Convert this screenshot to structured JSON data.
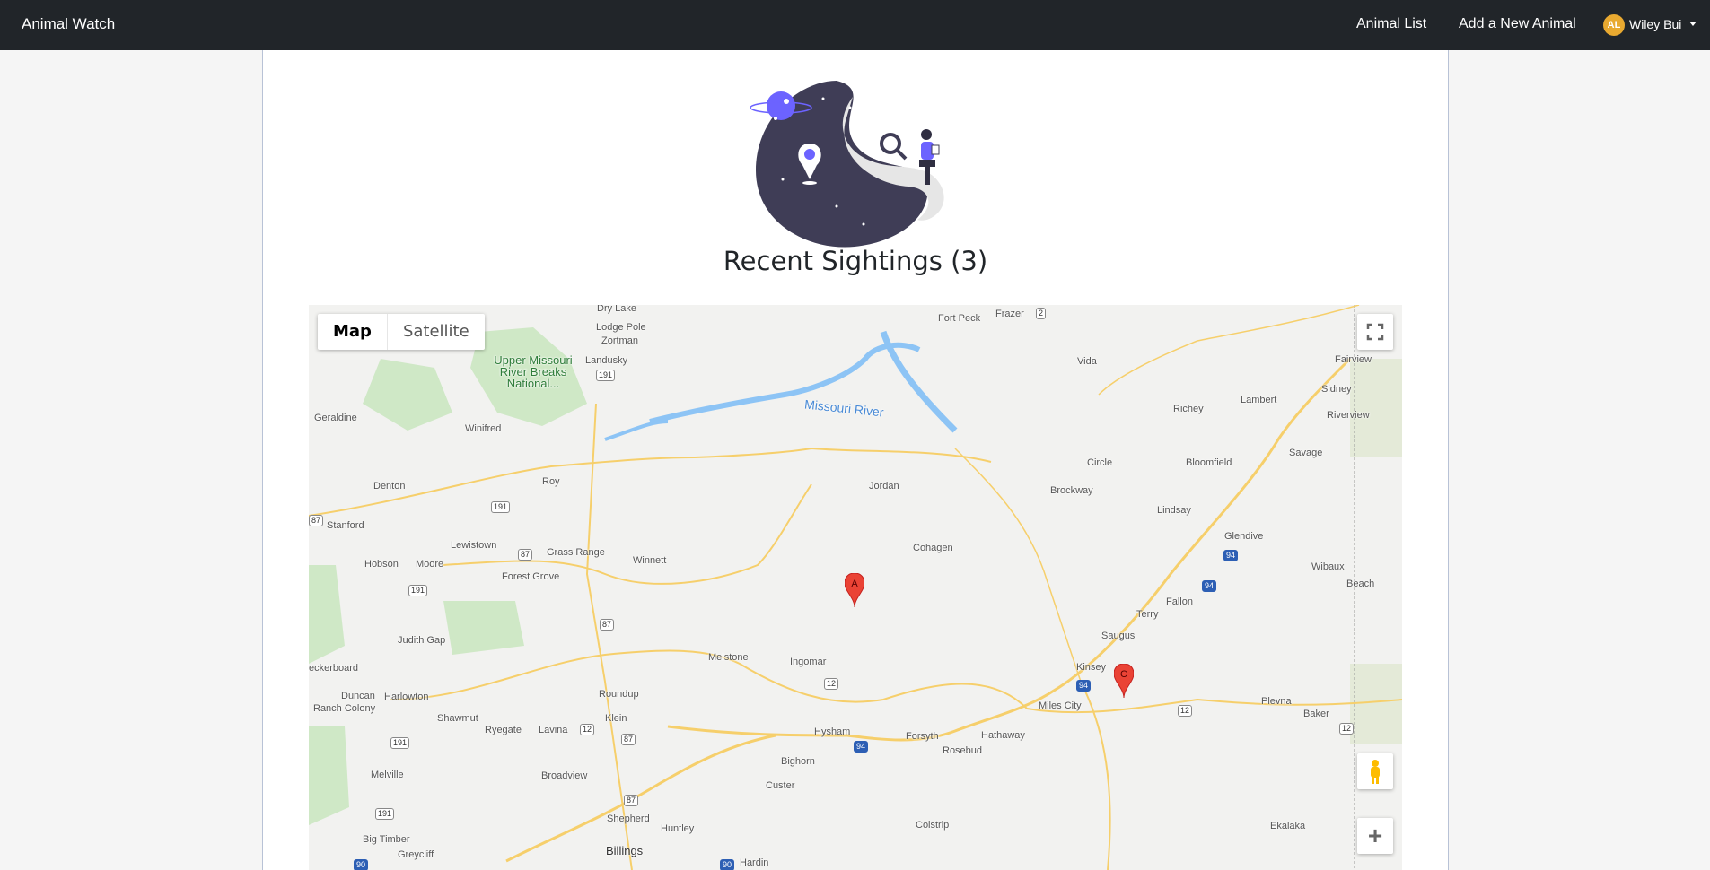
{
  "navbar": {
    "brand": "Animal Watch",
    "links": [
      "Animal List",
      "Add a New Animal"
    ],
    "user": {
      "initials": "AL",
      "name": "Wiley Bui"
    }
  },
  "page": {
    "title": "Recent Sightings (3)"
  },
  "map": {
    "map_type": {
      "map": "Map",
      "satellite": "Satellite"
    },
    "zoom_in": "+",
    "markers": [
      "A",
      "C"
    ],
    "places": [
      "Dry Lake",
      "Lodge Pole",
      "Zortman",
      "Landusky",
      "Upper Missouri River Breaks National...",
      "Geraldine",
      "Winifred",
      "Denton",
      "Roy",
      "Stanford",
      "Lewistown",
      "Grass Range",
      "Winnett",
      "Hobson",
      "Moore",
      "Forest Grove",
      "Judith Gap",
      "eckerboard",
      "Duncan",
      "Harlowton",
      "Ranch Colony",
      "Shawmut",
      "Ryegate",
      "Lavina",
      "Klein",
      "Roundup",
      "Melstone",
      "Ingomar",
      "Melville",
      "Broadview",
      "Big Timber",
      "Greycliff",
      "Shepherd",
      "Huntley",
      "Billings",
      "Hardin",
      "Bighorn",
      "Custer",
      "Hysham",
      "Forsyth",
      "Rosebud",
      "Hathaway",
      "Colstrip",
      "Jordan",
      "Cohagen",
      "Fort Peck",
      "Frazer",
      "Vida",
      "Missouri River",
      "Circle",
      "Brockway",
      "Richey",
      "Lambert",
      "Sidney",
      "Fairview",
      "Riverview",
      "Savage",
      "Bloomfield",
      "Lindsay",
      "Glendive",
      "Wibaux",
      "Beach",
      "Fallon",
      "Terry",
      "Saugus",
      "Kinsey",
      "Miles City",
      "Plevna",
      "Baker",
      "Ekalaka"
    ],
    "shields": [
      "2",
      "191",
      "191",
      "87",
      "87",
      "191",
      "87",
      "12",
      "87",
      "191",
      "191",
      "12",
      "94",
      "94",
      "94",
      "94",
      "12",
      "12",
      "90",
      "90",
      "87"
    ]
  }
}
